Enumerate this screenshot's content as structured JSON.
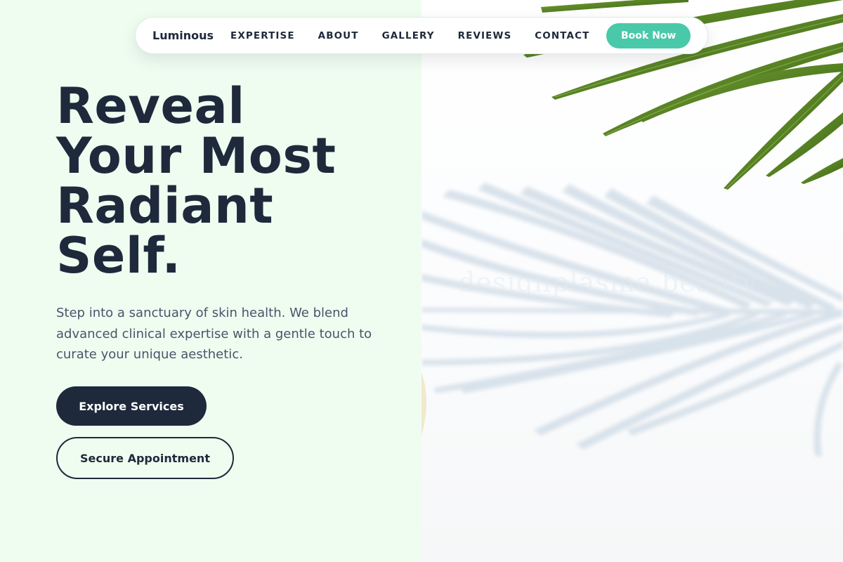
{
  "nav": {
    "brand": "Luminous",
    "links": [
      "EXPERTISE",
      "ABOUT",
      "GALLERY",
      "REVIEWS",
      "CONTACT"
    ],
    "cta": "Book Now"
  },
  "hero": {
    "title_lines": [
      "Reveal",
      "Your Most",
      "Radiant",
      "Self."
    ],
    "description": "Step into a sanctuary of skin health. We blend advanced clinical expertise with a gentle touch to curate your unique aesthetic.",
    "primary_button": "Explore Services",
    "secondary_button": "Secure Appointment"
  },
  "image": {
    "subject": "palm leaf with shadow on white background",
    "watermark_text": "designplasma beauty"
  },
  "colors": {
    "background_left": "#effdf1",
    "text_dark": "#1e293b",
    "text_muted": "#475569",
    "accent": "#49c9a9"
  }
}
